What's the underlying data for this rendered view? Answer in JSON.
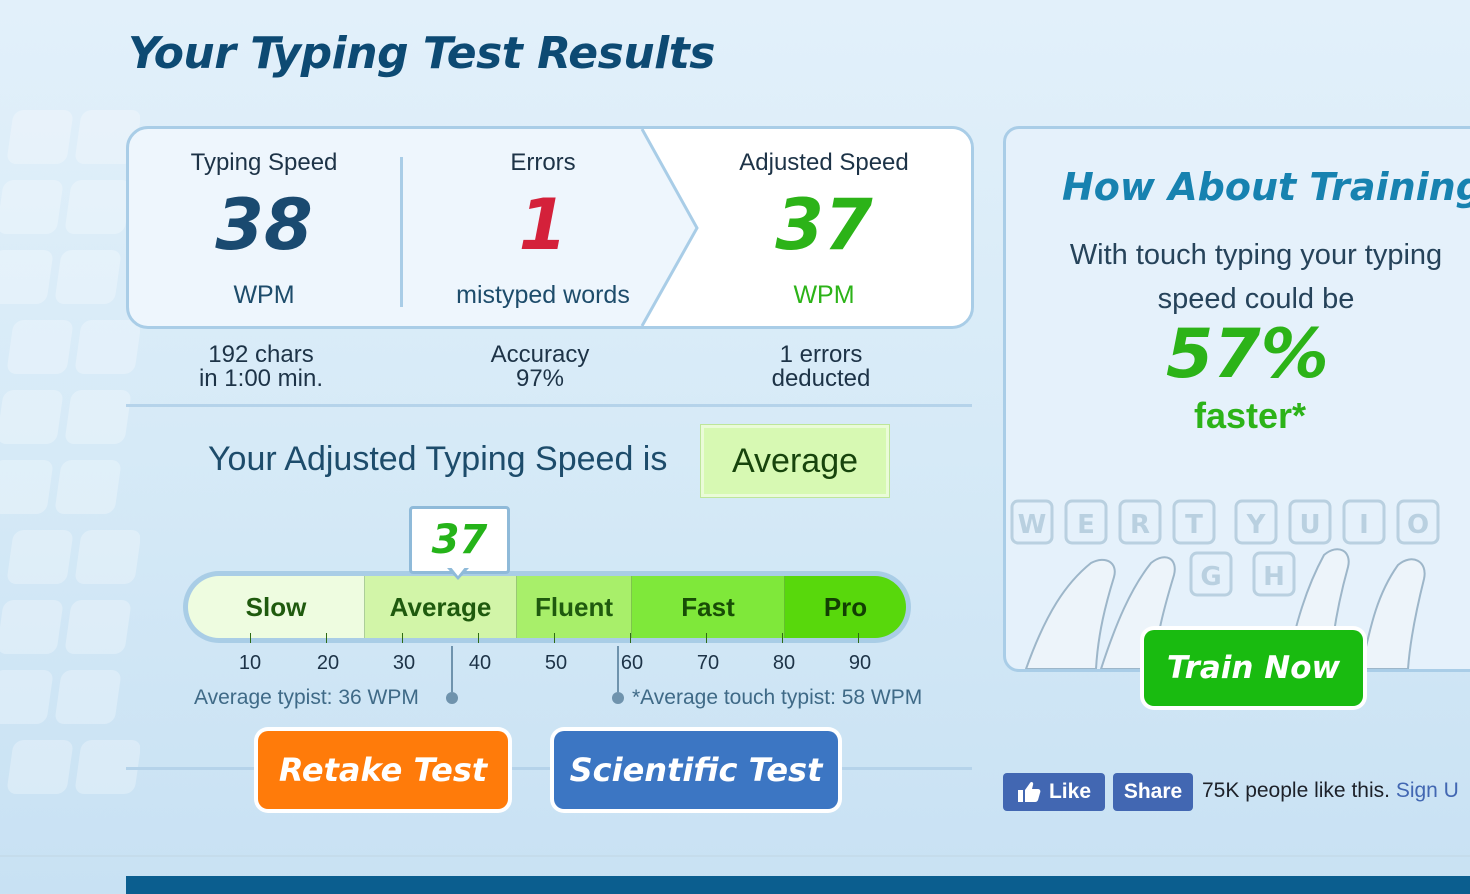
{
  "page": {
    "title": "Your Typing Test Results"
  },
  "results": {
    "typing_speed": {
      "label": "Typing Speed",
      "value": "38",
      "unit": "WPM",
      "color": "#1a4a70"
    },
    "errors": {
      "label": "Errors",
      "value": "1",
      "unit": "mistyped words",
      "color": "#d4213a"
    },
    "adjusted_speed": {
      "label": "Adjusted Speed",
      "value": "37",
      "unit": "WPM",
      "color": "#2cb318"
    }
  },
  "details": {
    "chars": "192 chars",
    "time": "in 1:00 min.",
    "accuracy_label": "Accuracy",
    "accuracy_value": "97%",
    "errors_deducted_1": "1 errors",
    "errors_deducted_2": "deducted"
  },
  "rating": {
    "text": "Your Adjusted Typing Speed is",
    "level": "Average"
  },
  "scale": {
    "marker_value": "37",
    "segments": [
      "Slow",
      "Average",
      "Fluent",
      "Fast",
      "Pro"
    ],
    "ticks": [
      "10",
      "20",
      "30",
      "40",
      "50",
      "60",
      "70",
      "80",
      "90"
    ],
    "average_typist": "Average typist: 36 WPM",
    "touch_typist": "*Average touch typist: 58 WPM"
  },
  "buttons": {
    "retake": "Retake Test",
    "scientific": "Scientific Test"
  },
  "training": {
    "title": "How About Training?",
    "text_line1": "With touch typing your typing",
    "text_line2": "speed could be",
    "percent": "57%",
    "faster": "faster*",
    "keys_row1": [
      "W",
      "E",
      "R",
      "T",
      "Y",
      "U",
      "I",
      "O"
    ],
    "keys_row2": [
      "G",
      "H"
    ],
    "button": "Train Now"
  },
  "social": {
    "like": "Like",
    "share": "Share",
    "text": "75K people like this.",
    "signup": "Sign U"
  }
}
